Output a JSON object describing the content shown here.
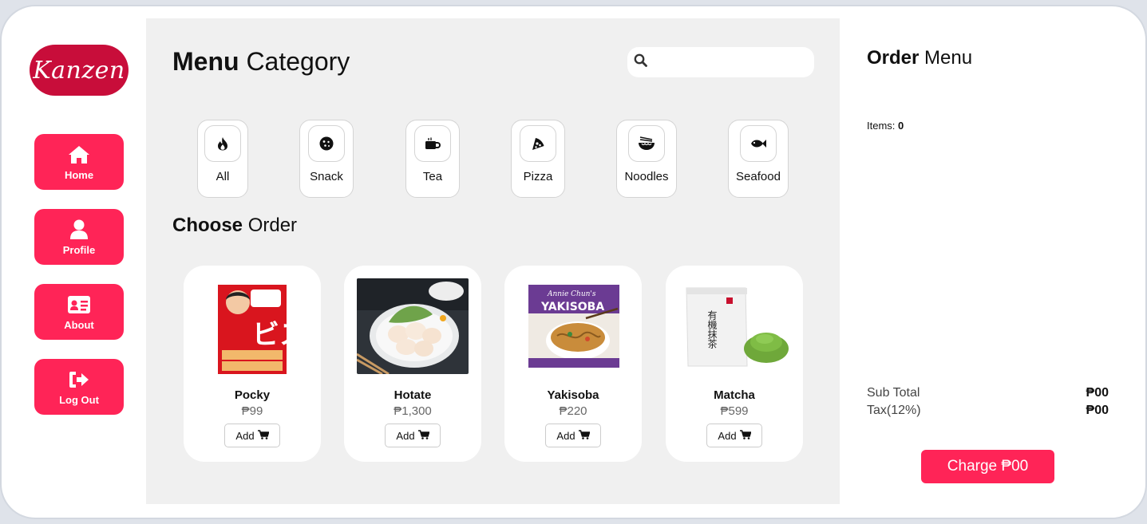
{
  "brand": {
    "logo_text": "Kanzen",
    "color": "#c80d3a"
  },
  "accent": "#ff2457",
  "sidebar": {
    "items": [
      {
        "label": "Home",
        "icon": "home-icon"
      },
      {
        "label": "Profile",
        "icon": "user-icon"
      },
      {
        "label": "About",
        "icon": "id-card-icon"
      },
      {
        "label": "Log Out",
        "icon": "logout-icon"
      }
    ]
  },
  "main": {
    "title_bold": "Menu",
    "title_rest": "Category",
    "search": {
      "placeholder": "",
      "value": ""
    },
    "categories": [
      {
        "label": "All",
        "icon": "fire-icon"
      },
      {
        "label": "Snack",
        "icon": "cookie-icon"
      },
      {
        "label": "Tea",
        "icon": "mug-icon"
      },
      {
        "label": "Pizza",
        "icon": "pizza-slice-icon"
      },
      {
        "label": "Noodles",
        "icon": "noodle-bowl-icon"
      },
      {
        "label": "Seafood",
        "icon": "fish-icon"
      }
    ],
    "choose_bold": "Choose",
    "choose_rest": "Order",
    "products": [
      {
        "name": "Pocky",
        "price": "₱99",
        "add_label": "Add"
      },
      {
        "name": "Hotate",
        "price": "₱1,300",
        "add_label": "Add"
      },
      {
        "name": "Yakisoba",
        "price": "₱220",
        "add_label": "Add"
      },
      {
        "name": "Matcha",
        "price": "₱599",
        "add_label": "Add"
      }
    ]
  },
  "order": {
    "title_bold": "Order",
    "title_rest": "Menu",
    "items_label": "Items:",
    "items_count": "0",
    "subtotal_label": "Sub Total",
    "subtotal_value": "₱00",
    "tax_label": "Tax(12%)",
    "tax_value": "₱00",
    "charge_label": "Charge ₱00"
  },
  "product_image_text": {
    "pocky": "ビスコ",
    "yakisoba_brand": "Annie Chun's",
    "yakisoba_title": "YAKISOBA",
    "matcha": "有機抹茶"
  }
}
